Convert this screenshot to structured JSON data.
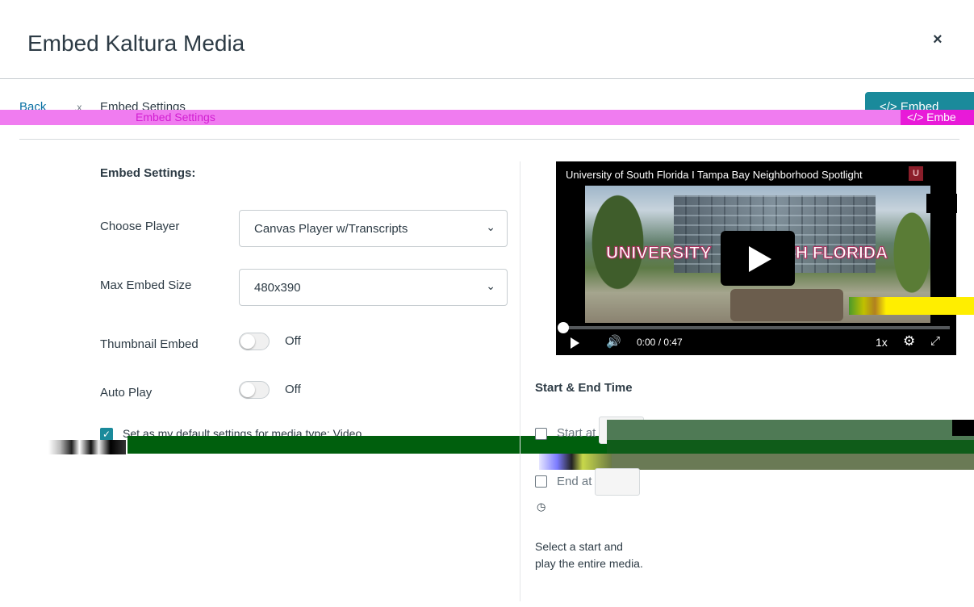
{
  "modal": {
    "title": "Embed Kaltura Media",
    "close_label": "×"
  },
  "toolbar": {
    "back_label": "Back",
    "separator": ".x",
    "breadcrumb_current": "Embed Settings",
    "breadcrumb_overlay": "Embed Settings",
    "embed_button_label": "</> Embed",
    "embed_button_overlay": "</> Embe",
    "accent_color": "#1a8a9b"
  },
  "settings": {
    "heading": "Embed Settings:",
    "choose_player_label": "Choose Player",
    "choose_player_value": "Canvas Player w/Transcripts",
    "max_size_label": "Max Embed Size",
    "max_size_value": "480x390",
    "thumbnail_label": "Thumbnail Embed",
    "thumbnail_state": "Off",
    "autoplay_label": "Auto Play",
    "autoplay_state": "Off",
    "default_text": "Set as my default settings for media type: Video"
  },
  "player": {
    "title": "University of South Florida I Tampa Bay Neighborhood Spotlight",
    "logo": "U",
    "banner_left": "UNIVERSITY",
    "banner_right": "TH FLORIDA",
    "time": "0:00 / 0:47",
    "speed": "1x",
    "progress": 0
  },
  "time_range": {
    "heading": "Start & End Time",
    "start_label": "Start at",
    "end_label": "End at",
    "help_line1": "Select a start and",
    "help_line2": "play the entire media."
  },
  "icons": {
    "chevron": "chevron-down-icon",
    "clock": "clock-icon",
    "volume": "volume-icon",
    "gear": "gear-icon",
    "fullscreen": "fullscreen-icon"
  }
}
